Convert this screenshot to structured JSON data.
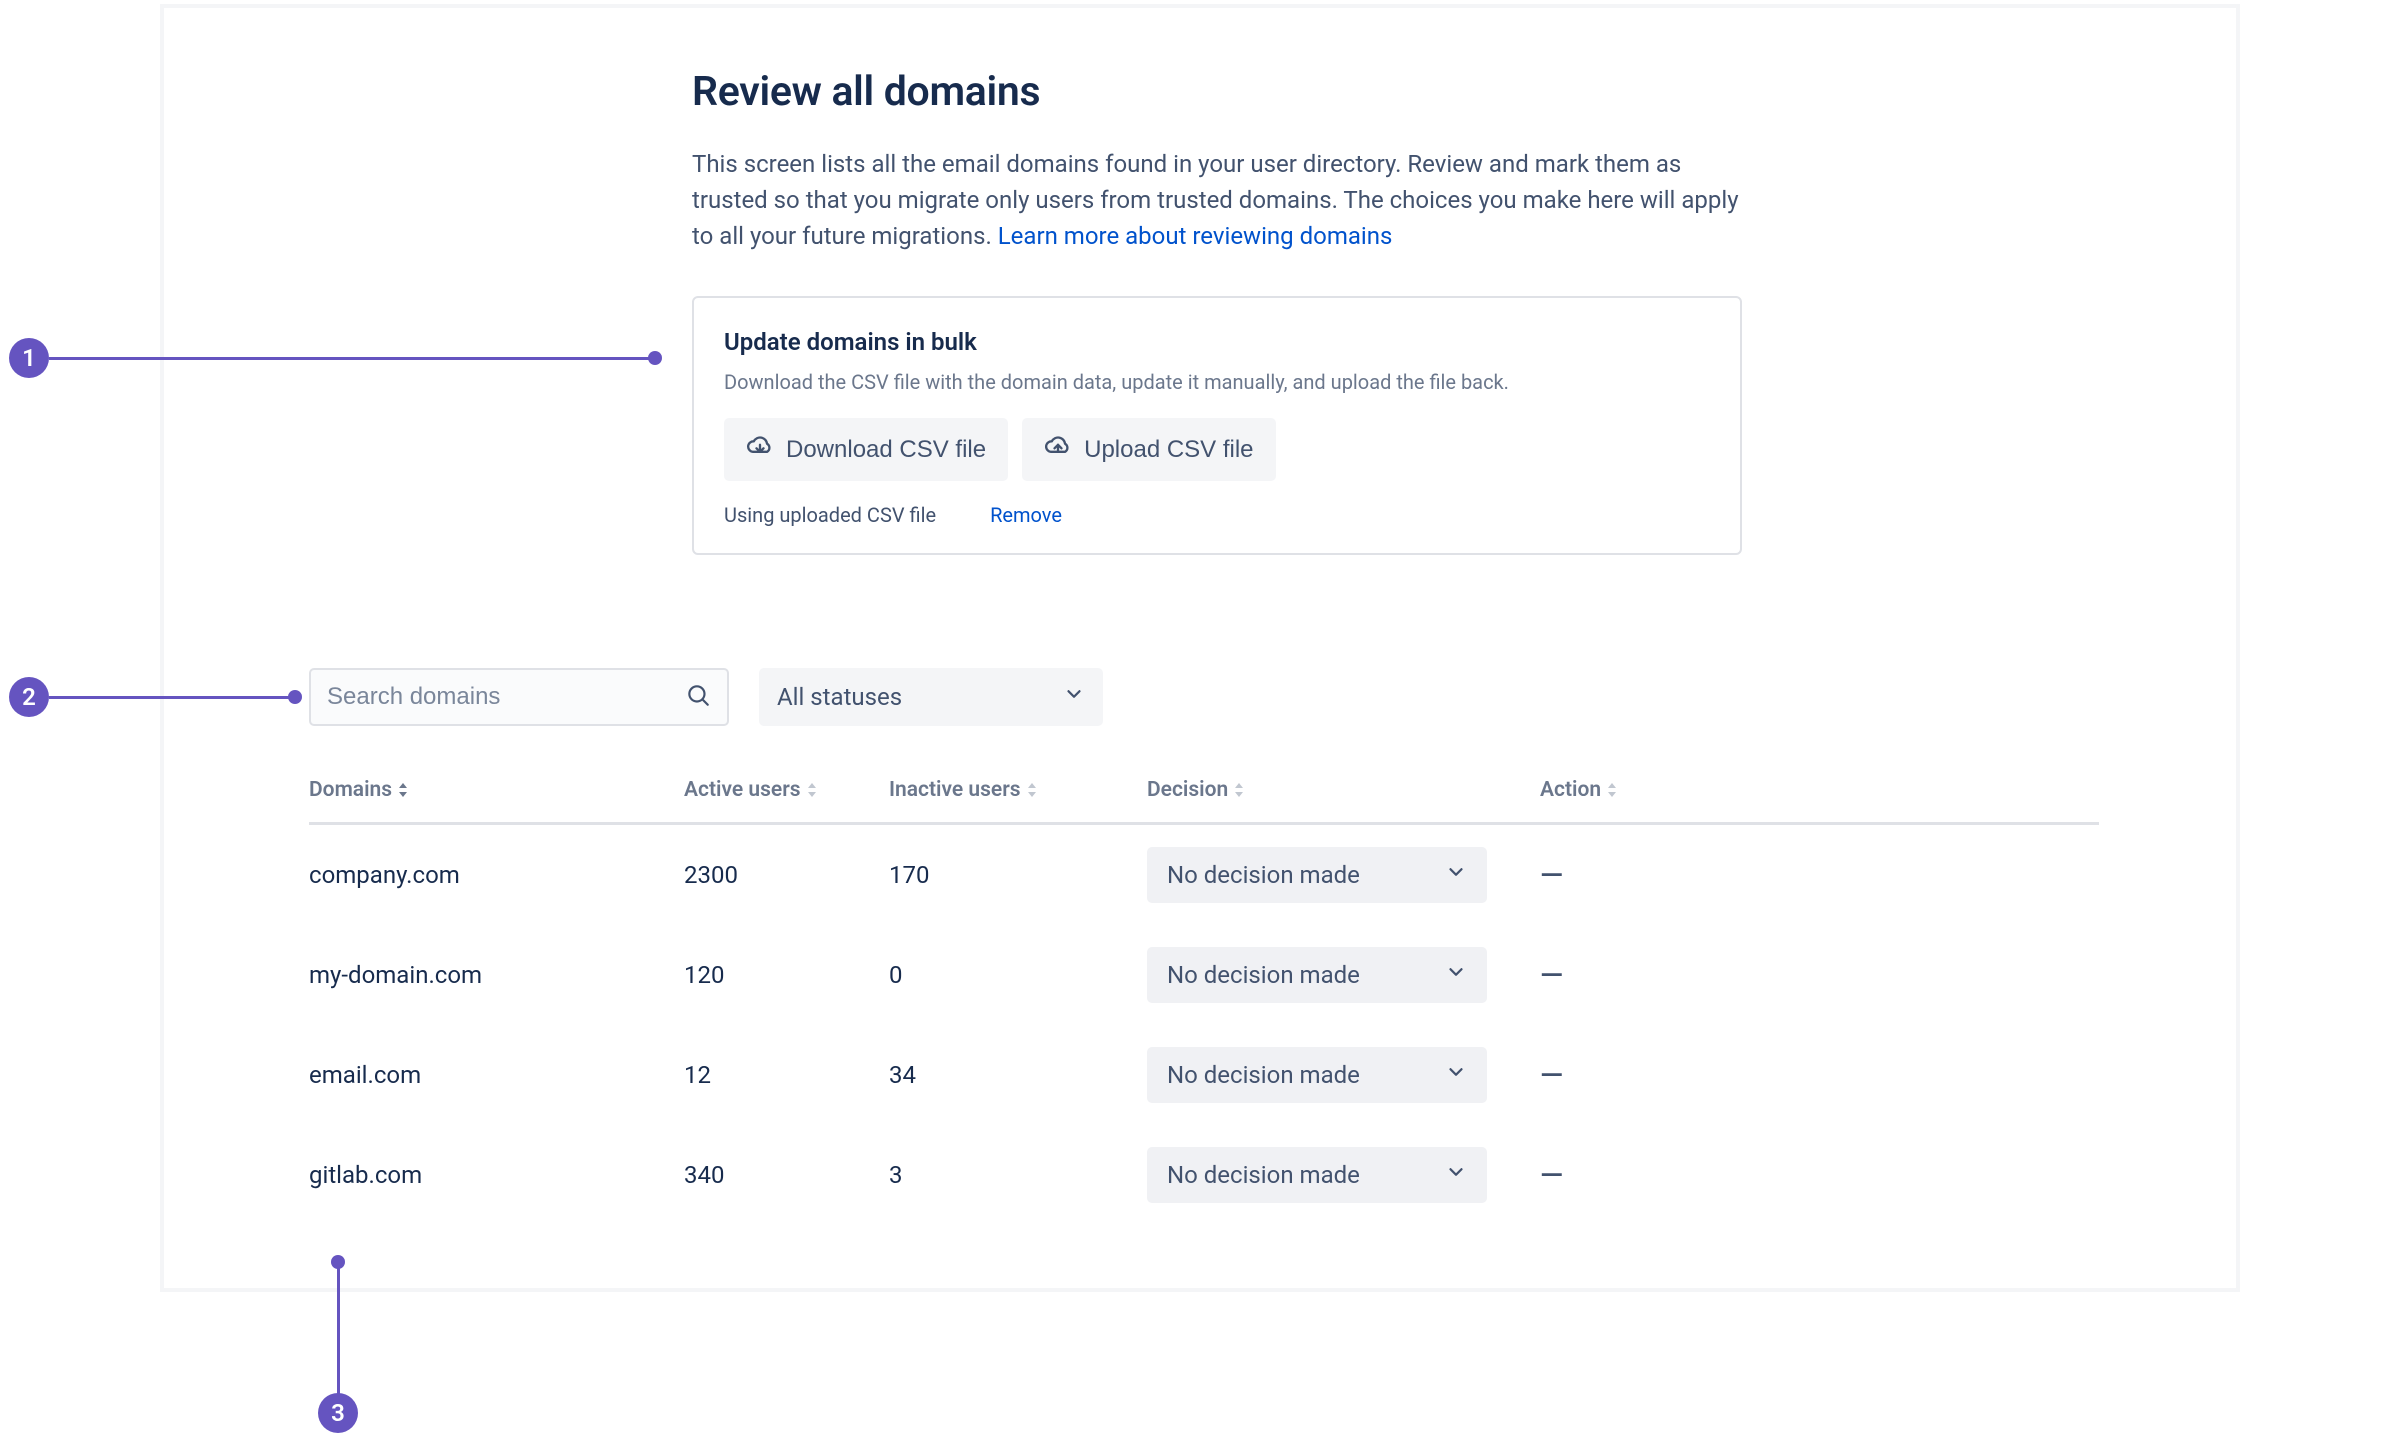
{
  "page": {
    "title": "Review all domains",
    "description": "This screen lists all the email domains found in your user directory. Review and mark them as trusted so that you migrate only users from trusted domains. The choices you make here will apply to all your future migrations. ",
    "learn_more": "Learn more about reviewing domains"
  },
  "bulk": {
    "title": "Update domains in bulk",
    "description": "Download the CSV file with the domain data, update it manually, and upload the file back.",
    "download_label": "Download CSV file",
    "upload_label": "Upload CSV file",
    "status_text": "Using uploaded CSV file",
    "remove_label": "Remove"
  },
  "filters": {
    "search_placeholder": "Search domains",
    "status_selected": "All statuses"
  },
  "table": {
    "columns": {
      "domains": "Domains",
      "active": "Active users",
      "inactive": "Inactive users",
      "decision": "Decision",
      "action": "Action"
    },
    "decision_default": "No decision made",
    "action_placeholder": "—",
    "rows": [
      {
        "domain": "company.com",
        "active": "2300",
        "inactive": "170"
      },
      {
        "domain": "my-domain.com",
        "active": "120",
        "inactive": "0"
      },
      {
        "domain": "email.com",
        "active": "12",
        "inactive": "34"
      },
      {
        "domain": "gitlab.com",
        "active": "340",
        "inactive": "3"
      }
    ]
  },
  "callouts": {
    "one": "1",
    "two": "2",
    "three": "3"
  }
}
